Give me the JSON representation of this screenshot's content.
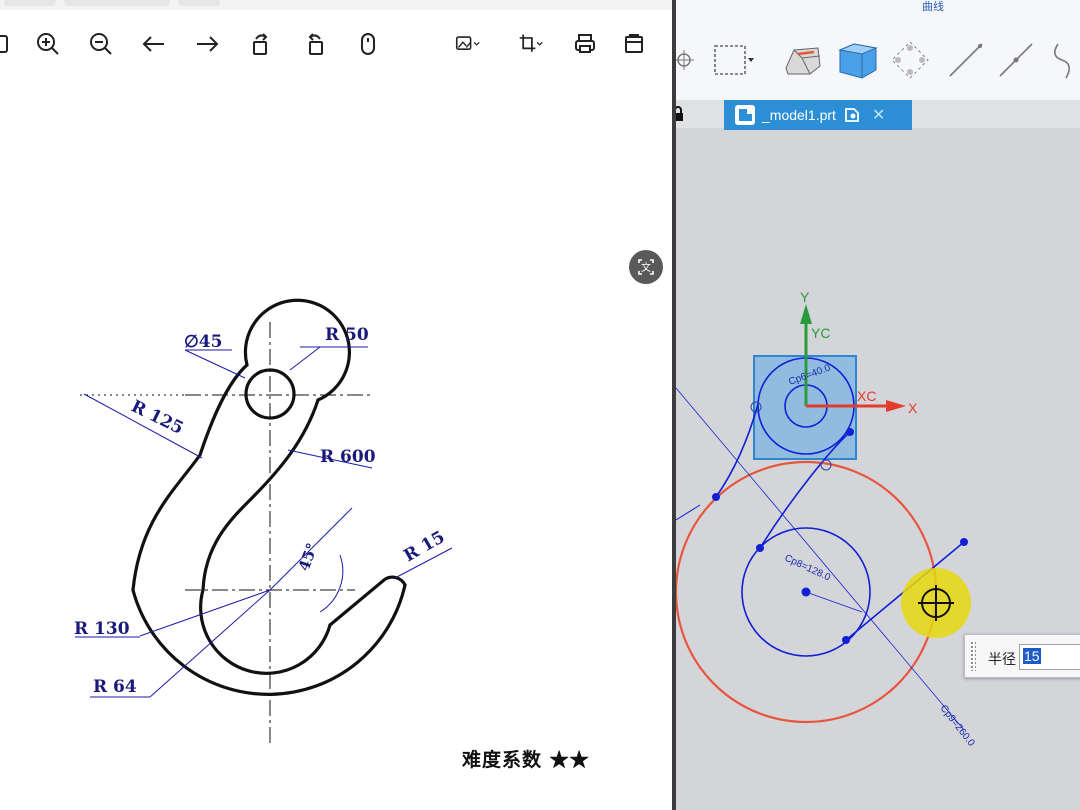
{
  "viewer": {
    "toolbar": {
      "zoom_in": "zoom-in",
      "zoom_out": "zoom-out",
      "prev": "previous-image",
      "next": "next-image",
      "rotate_left": "rotate-left",
      "rotate_right": "rotate-right",
      "mouse": "mouse-mode",
      "edit_image": "edit-image",
      "crop": "crop",
      "print": "print",
      "save": "save"
    },
    "drawing": {
      "labels": {
        "diameter": "∅45",
        "r50": "R 50",
        "r125": "R 125",
        "r600": "R 600",
        "angle": "45°",
        "r15": "R 15",
        "r130": "R 130",
        "r64": "R 64"
      }
    },
    "difficulty": "难度系数 ★★"
  },
  "cad": {
    "ribbon_group_label": "曲线",
    "tab": {
      "label": "_model1.prt"
    },
    "viewport": {
      "axis_labels": {
        "y": "Y",
        "yc": "YC",
        "xc": "XC",
        "x": "X"
      },
      "dims": {
        "d_small": "Cp8=128.0",
        "d_large": "Cp9=260.0",
        "d_top": "Cp6=40.0"
      }
    },
    "radius_prompt": {
      "label": "半径",
      "value": "15"
    }
  },
  "colors": {
    "arc_orange": "#e8553e",
    "sketch_blue": "#1020d6",
    "tab_blue": "#2c8fd6",
    "x_axis": "#e53b2a",
    "y_axis": "#2b9a3b"
  }
}
